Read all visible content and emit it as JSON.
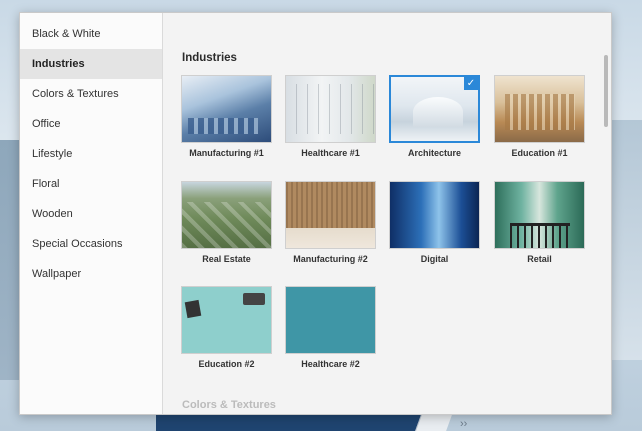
{
  "sidebar": {
    "items": [
      {
        "label": "Black & White",
        "active": false
      },
      {
        "label": "Industries",
        "active": true
      },
      {
        "label": "Colors & Textures",
        "active": false
      },
      {
        "label": "Office",
        "active": false
      },
      {
        "label": "Lifestyle",
        "active": false
      },
      {
        "label": "Floral",
        "active": false
      },
      {
        "label": "Wooden",
        "active": false
      },
      {
        "label": "Special Occasions",
        "active": false
      },
      {
        "label": "Wallpaper",
        "active": false
      }
    ]
  },
  "main": {
    "section_title": "Industries",
    "next_section_title": "Colors & Textures",
    "tiles": [
      {
        "label": "Manufacturing #1",
        "selected": false
      },
      {
        "label": "Healthcare #1",
        "selected": false
      },
      {
        "label": "Architecture",
        "selected": true
      },
      {
        "label": "Education #1",
        "selected": false
      },
      {
        "label": "Real Estate",
        "selected": false
      },
      {
        "label": "Manufacturing #2",
        "selected": false
      },
      {
        "label": "Digital",
        "selected": false
      },
      {
        "label": "Retail",
        "selected": false
      },
      {
        "label": "Education #2",
        "selected": false
      },
      {
        "label": "Healthcare #2",
        "selected": false
      }
    ],
    "selected_check_icon": "check-icon"
  },
  "colors": {
    "accent": "#2b88d8",
    "active_bg": "#e4e4e4"
  }
}
